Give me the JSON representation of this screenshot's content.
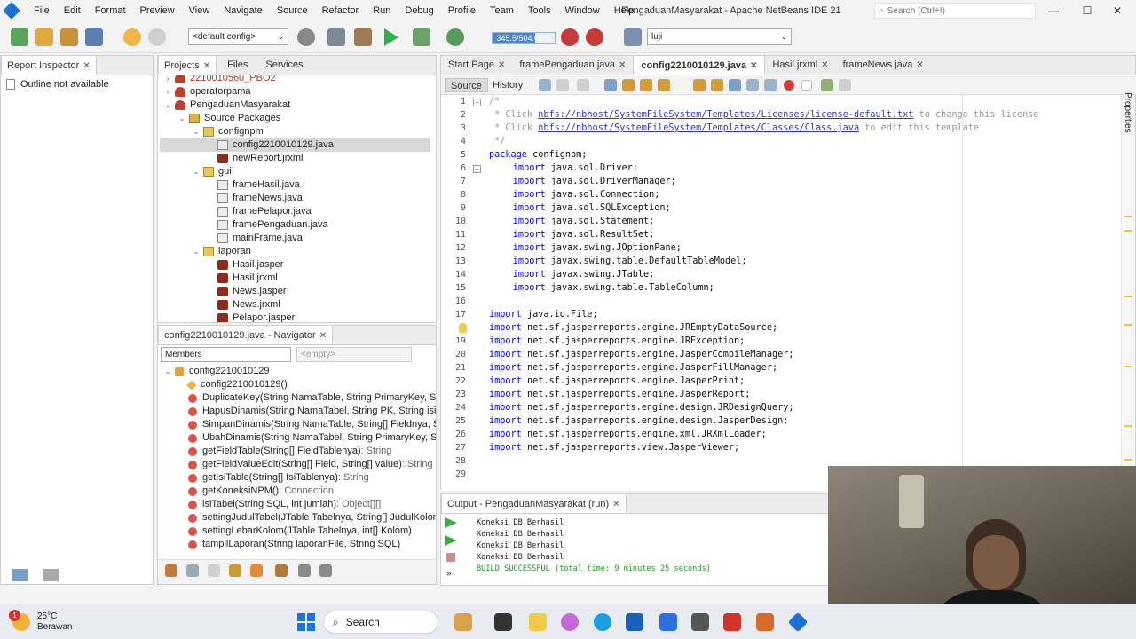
{
  "window": {
    "title": "PengaduanMasyarakat - Apache NetBeans IDE 21",
    "search_placeholder": "Search (Ctrl+I)",
    "controls": [
      "—",
      "☐",
      "✕"
    ]
  },
  "menu": [
    "File",
    "Edit",
    "Format",
    "Preview",
    "View",
    "Navigate",
    "Source",
    "Refactor",
    "Run",
    "Debug",
    "Profile",
    "Team",
    "Tools",
    "Window",
    "Help"
  ],
  "toolbar": {
    "config": "<default config>",
    "memory": "345.5/504.0MB",
    "memory_used_fraction": 0.685,
    "project_select": "luji"
  },
  "report_inspector": {
    "tab": "Report Inspector",
    "outline": "Outline not available"
  },
  "projects": {
    "tabs": [
      "Projects",
      "Files",
      "Services"
    ],
    "tree": [
      {
        "label": "2210010560_PBO2",
        "level": 0,
        "icon": "cup",
        "exp": "›"
      },
      {
        "label": "operatorpama",
        "level": 0,
        "icon": "cup",
        "exp": "›"
      },
      {
        "label": "PengaduanMasyarakat",
        "level": 0,
        "icon": "cup",
        "exp": "⌄"
      },
      {
        "label": "Source Packages",
        "level": 1,
        "icon": "srcpkg",
        "exp": "⌄"
      },
      {
        "label": "confignpm",
        "level": 2,
        "icon": "pkg",
        "exp": "⌄"
      },
      {
        "label": "config2210010129.java",
        "level": 3,
        "icon": "java",
        "exp": "",
        "selected": true
      },
      {
        "label": "newReport.jrxml",
        "level": 3,
        "icon": "jrx",
        "exp": ""
      },
      {
        "label": "gui",
        "level": 2,
        "icon": "pkg",
        "exp": "⌄"
      },
      {
        "label": "frameHasil.java",
        "level": 3,
        "icon": "java",
        "exp": ""
      },
      {
        "label": "frameNews.java",
        "level": 3,
        "icon": "java",
        "exp": ""
      },
      {
        "label": "framePelapor.java",
        "level": 3,
        "icon": "java",
        "exp": ""
      },
      {
        "label": "framePengaduan.java",
        "level": 3,
        "icon": "java",
        "exp": ""
      },
      {
        "label": "mainFrame.java",
        "level": 3,
        "icon": "java",
        "exp": ""
      },
      {
        "label": "laporan",
        "level": 2,
        "icon": "pkg",
        "exp": "⌄"
      },
      {
        "label": "Hasil.jasper",
        "level": 3,
        "icon": "jrx",
        "exp": ""
      },
      {
        "label": "Hasil.jrxml",
        "level": 3,
        "icon": "jrx",
        "exp": ""
      },
      {
        "label": "News.jasper",
        "level": 3,
        "icon": "jrx",
        "exp": ""
      },
      {
        "label": "News.jrxml",
        "level": 3,
        "icon": "jrx",
        "exp": ""
      },
      {
        "label": "Pelapor.jasper",
        "level": 3,
        "icon": "jrx",
        "exp": ""
      }
    ]
  },
  "navigator": {
    "tab": "config2210010129.java - Navigator",
    "filter": "Members",
    "empty": "<empty>",
    "root": "config2210010129",
    "members": [
      {
        "name": "config2210010129()",
        "type": "",
        "kind": "ctor"
      },
      {
        "name": "DuplicateKey(String NamaTable, String PrimaryKey, String",
        "type": "",
        "kind": "method"
      },
      {
        "name": "HapusDinamis(String NamaTabel, String PK, String isi)",
        "type": "",
        "kind": "method"
      },
      {
        "name": "SimpanDinamis(String NamaTable, String[] Fieldnya, String",
        "type": "",
        "kind": "method"
      },
      {
        "name": "UbahDinamis(String NamaTabel, String PrimaryKey, String",
        "type": "",
        "kind": "method"
      },
      {
        "name": "getFieldTable(String[] FieldTablenya)",
        "type": " : String",
        "kind": "method"
      },
      {
        "name": "getFieldValueEdit(String[] Field, String[] value)",
        "type": " : String",
        "kind": "method"
      },
      {
        "name": "getIsiTable(String[] IsiTablenya)",
        "type": " : String",
        "kind": "method"
      },
      {
        "name": "getKoneksiNPM()",
        "type": " : Connection",
        "kind": "method"
      },
      {
        "name": "isiTabel(String SQL, int jumlah)",
        "type": " : Object[][]",
        "kind": "method"
      },
      {
        "name": "settingJudulTabel(JTable Tabelnya, String[] JudulKolom)",
        "type": "",
        "kind": "method"
      },
      {
        "name": "settingLebarKolom(JTable Tabelnya, int[] Kolom)",
        "type": "",
        "kind": "method"
      },
      {
        "name": "tampilLaporan(String laporanFile, String SQL)",
        "type": "",
        "kind": "method"
      }
    ]
  },
  "editor": {
    "tabs": [
      {
        "label": "Start Page",
        "active": false
      },
      {
        "label": "framePengaduan.java",
        "active": false
      },
      {
        "label": "config2210010129.java",
        "active": true
      },
      {
        "label": "Hasil.jrxml",
        "active": false
      },
      {
        "label": "frameNews.java",
        "active": false
      }
    ],
    "source_label": "Source",
    "history_label": "History",
    "lines": [
      {
        "n": "1",
        "parts": [
          {
            "t": "/*",
            "c": "cm"
          }
        ],
        "indent": 0
      },
      {
        "n": "2",
        "parts": [
          {
            "t": " * Click ",
            "c": "cm"
          },
          {
            "t": "nbfs://nbhost/SystemFileSystem/Templates/Licenses/license-default.txt",
            "c": "lnk"
          },
          {
            "t": " to change this license",
            "c": "cm"
          }
        ],
        "indent": 0
      },
      {
        "n": "3",
        "parts": [
          {
            "t": " * Click ",
            "c": "cm"
          },
          {
            "t": "nbfs://nbhost/SystemFileSystem/Templates/Classes/Class.java",
            "c": "lnk"
          },
          {
            "t": " to edit this template",
            "c": "cm"
          }
        ],
        "indent": 0
      },
      {
        "n": "4",
        "parts": [
          {
            "t": " */",
            "c": "cm"
          }
        ],
        "indent": 0
      },
      {
        "n": "5",
        "parts": [
          {
            "t": "package",
            "c": "kw"
          },
          {
            "t": " confignpm;",
            "c": ""
          }
        ],
        "indent": 0
      },
      {
        "n": "6",
        "parts": [
          {
            "t": "import",
            "c": "kw"
          },
          {
            "t": " java.sql.Driver;",
            "c": ""
          }
        ],
        "indent": 4
      },
      {
        "n": "7",
        "parts": [
          {
            "t": "import",
            "c": "kw"
          },
          {
            "t": " java.sql.DriverManager;",
            "c": ""
          }
        ],
        "indent": 4
      },
      {
        "n": "8",
        "parts": [
          {
            "t": "import",
            "c": "kw"
          },
          {
            "t": " java.sql.Connection;",
            "c": ""
          }
        ],
        "indent": 4
      },
      {
        "n": "9",
        "parts": [
          {
            "t": "import",
            "c": "kw"
          },
          {
            "t": " java.sql.SQLException;",
            "c": ""
          }
        ],
        "indent": 4
      },
      {
        "n": "10",
        "parts": [
          {
            "t": "import",
            "c": "kw"
          },
          {
            "t": " java.sql.Statement;",
            "c": ""
          }
        ],
        "indent": 4
      },
      {
        "n": "11",
        "parts": [
          {
            "t": "import",
            "c": "kw"
          },
          {
            "t": " java.sql.ResultSet;",
            "c": ""
          }
        ],
        "indent": 4
      },
      {
        "n": "12",
        "parts": [
          {
            "t": "import",
            "c": "kw"
          },
          {
            "t": " javax.swing.JOptionPane;",
            "c": ""
          }
        ],
        "indent": 4
      },
      {
        "n": "13",
        "parts": [
          {
            "t": "import",
            "c": "kw"
          },
          {
            "t": " javax.swing.table.DefaultTableModel;",
            "c": ""
          }
        ],
        "indent": 4
      },
      {
        "n": "14",
        "parts": [
          {
            "t": "import",
            "c": "kw"
          },
          {
            "t": " javax.swing.JTable;",
            "c": ""
          }
        ],
        "indent": 4
      },
      {
        "n": "15",
        "parts": [
          {
            "t": "import",
            "c": "kw"
          },
          {
            "t": " javax.swing.table.TableColumn;",
            "c": ""
          }
        ],
        "indent": 4
      },
      {
        "n": "16",
        "parts": [],
        "indent": 0
      },
      {
        "n": "17",
        "parts": [
          {
            "t": "import",
            "c": "kw"
          },
          {
            "t": " java.io.File;",
            "c": ""
          }
        ],
        "indent": 0
      },
      {
        "n": "",
        "parts": [
          {
            "t": "import",
            "c": "kw"
          },
          {
            "t": " net.sf.jasperreports.engine.JREmptyDataSource;",
            "c": ""
          }
        ],
        "indent": 0
      },
      {
        "n": "19",
        "parts": [
          {
            "t": "import",
            "c": "kw"
          },
          {
            "t": " net.sf.jasperreports.engine.JRException;",
            "c": ""
          }
        ],
        "indent": 0
      },
      {
        "n": "20",
        "parts": [
          {
            "t": "import",
            "c": "kw"
          },
          {
            "t": " net.sf.jasperreports.engine.JasperCompileManager;",
            "c": ""
          }
        ],
        "indent": 0
      },
      {
        "n": "21",
        "parts": [
          {
            "t": "import",
            "c": "kw"
          },
          {
            "t": " net.sf.jasperreports.engine.JasperFillManager;",
            "c": ""
          }
        ],
        "indent": 0
      },
      {
        "n": "22",
        "parts": [
          {
            "t": "import",
            "c": "kw"
          },
          {
            "t": " net.sf.jasperreports.engine.JasperPrint;",
            "c": ""
          }
        ],
        "indent": 0
      },
      {
        "n": "23",
        "parts": [
          {
            "t": "import",
            "c": "kw"
          },
          {
            "t": " net.sf.jasperreports.engine.JasperReport;",
            "c": ""
          }
        ],
        "indent": 0
      },
      {
        "n": "24",
        "parts": [
          {
            "t": "import",
            "c": "kw"
          },
          {
            "t": " net.sf.jasperreports.engine.design.JRDesignQuery;",
            "c": ""
          }
        ],
        "indent": 0
      },
      {
        "n": "25",
        "parts": [
          {
            "t": "import",
            "c": "kw"
          },
          {
            "t": " net.sf.jasperreports.engine.design.JasperDesign;",
            "c": ""
          }
        ],
        "indent": 0
      },
      {
        "n": "26",
        "parts": [
          {
            "t": "import",
            "c": "kw"
          },
          {
            "t": " net.sf.jasperreports.engine.xml.JRXmlLoader;",
            "c": ""
          }
        ],
        "indent": 0
      },
      {
        "n": "27",
        "parts": [
          {
            "t": "import",
            "c": "kw"
          },
          {
            "t": " net.sf.jasperreports.view.JasperViewer;",
            "c": ""
          }
        ],
        "indent": 0
      },
      {
        "n": "28",
        "parts": [],
        "indent": 0
      },
      {
        "n": "29",
        "parts": [],
        "indent": 0
      }
    ]
  },
  "output": {
    "tab": "Output - PengaduanMasyarakat (run)",
    "lines": [
      {
        "t": "Koneksi DB Berhasil",
        "build": false
      },
      {
        "t": "Koneksi DB Berhasil",
        "build": false
      },
      {
        "t": "Koneksi DB Berhasil",
        "build": false
      },
      {
        "t": "Koneksi DB Berhasil",
        "build": false
      },
      {
        "t": "BUILD SUCCESSFUL (total time: 9 minutes 25 seconds)",
        "build": true
      }
    ]
  },
  "side": {
    "properties": "Properties"
  },
  "taskbar": {
    "temp": "25°C",
    "weather": "Berawan",
    "badge": "1",
    "search": "Search"
  },
  "colors": {
    "accent": "#1c6fd3",
    "keyword": "#0000e6",
    "comment": "#969696",
    "build_success": "#1e9a1e"
  }
}
